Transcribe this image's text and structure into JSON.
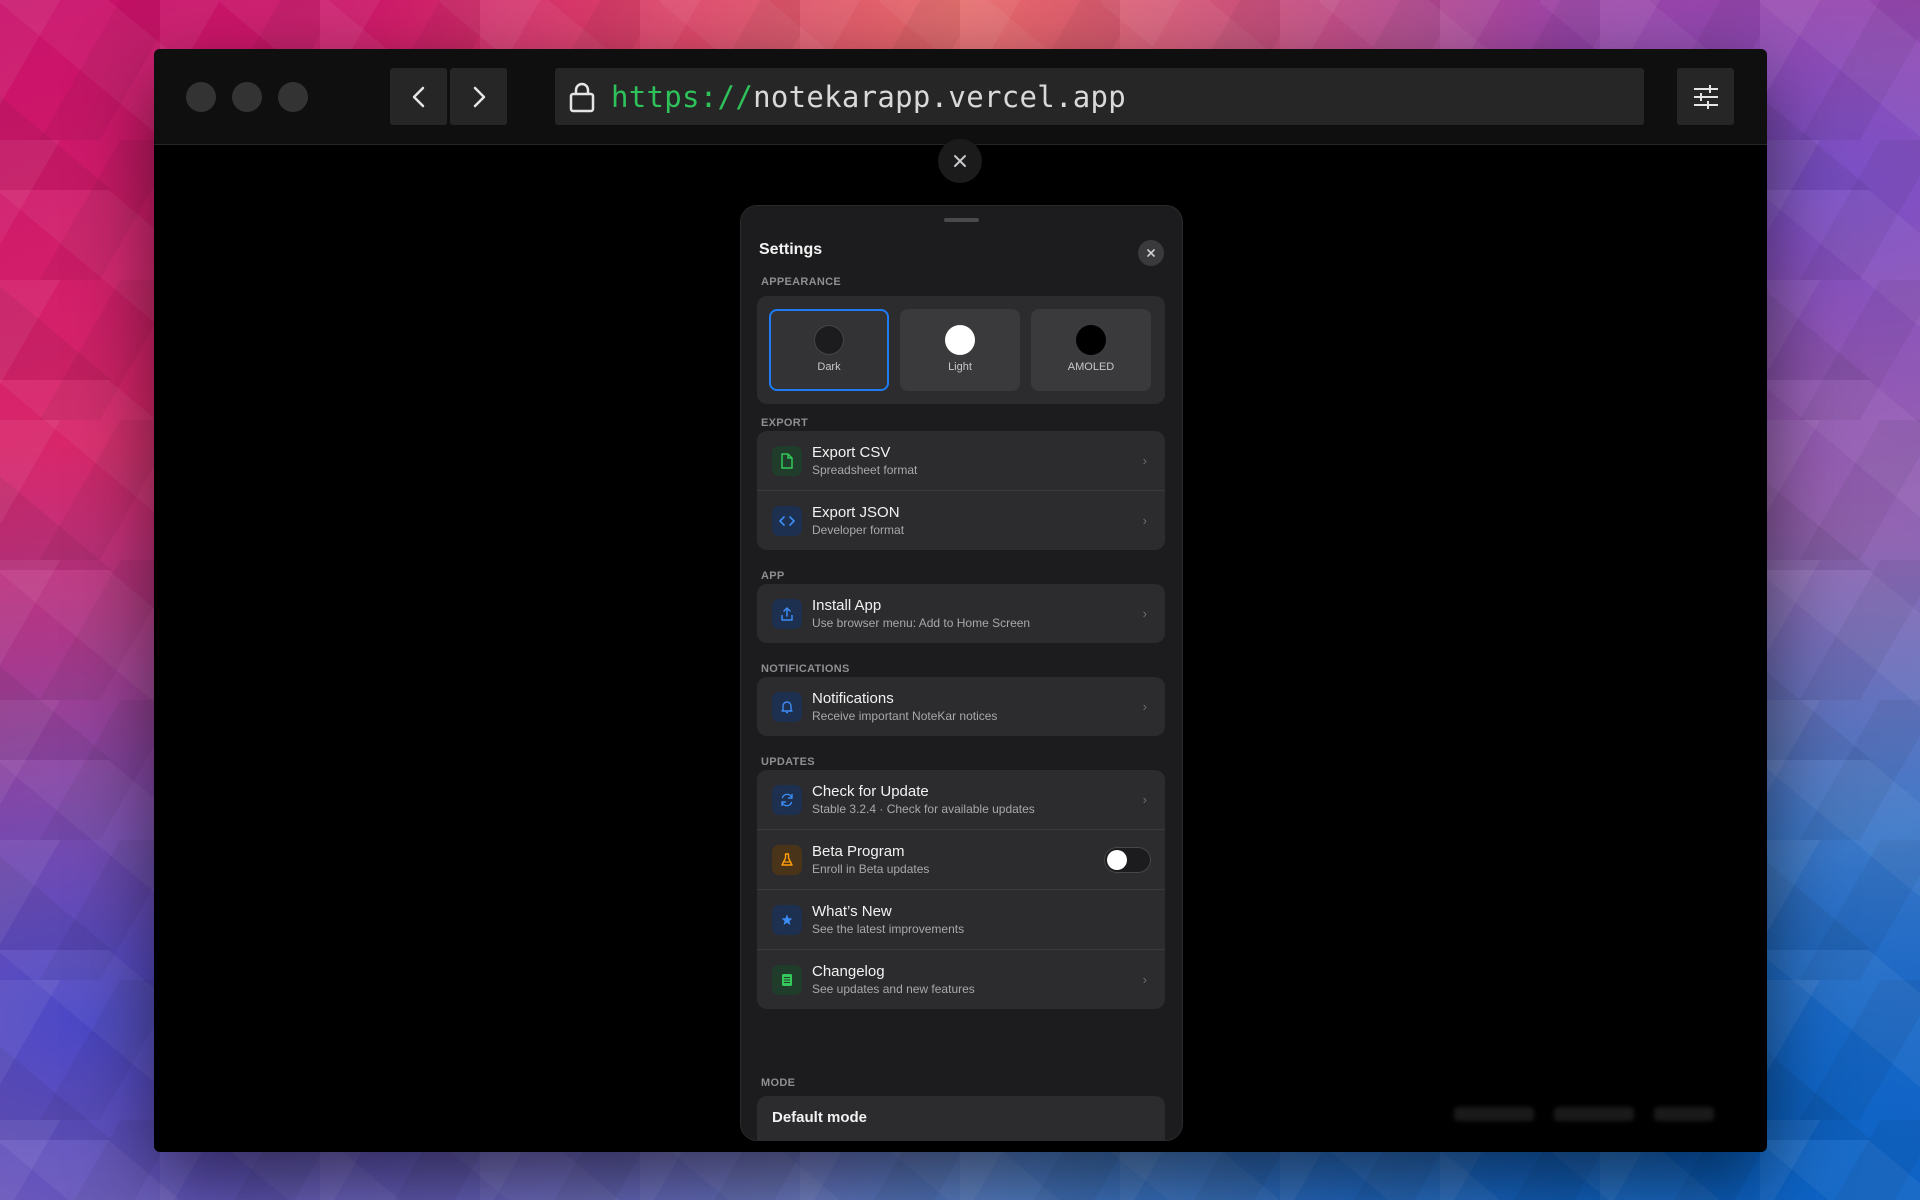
{
  "browser": {
    "url_scheme": "https://",
    "url_host": "notekarapp.vercel.app",
    "icons": {
      "back": "chevron-left-icon",
      "forward": "chevron-right-icon",
      "lock": "lock-icon",
      "menu": "sliders-icon"
    }
  },
  "settings": {
    "title": "Settings",
    "appearance": {
      "label": "APPEARANCE",
      "options": [
        {
          "name": "Dark",
          "swatch": "#1c1c1e"
        },
        {
          "name": "Light",
          "swatch": "#ffffff"
        },
        {
          "name": "AMOLED",
          "swatch": "#000000"
        }
      ],
      "selected": "Dark"
    },
    "export": {
      "label": "EXPORT",
      "items": [
        {
          "title": "Export CSV",
          "subtitle": "Spreadsheet format",
          "icon": "file-icon",
          "color": "#34c759"
        },
        {
          "title": "Export JSON",
          "subtitle": "Developer format",
          "icon": "code-icon",
          "color": "#1e7bf2"
        }
      ]
    },
    "app": {
      "label": "APP",
      "items": [
        {
          "title": "Install App",
          "subtitle": "Use browser menu: Add to Home Screen",
          "icon": "share-icon",
          "color": "#1e7bf2"
        }
      ]
    },
    "notifications": {
      "label": "NOTIFICATIONS",
      "items": [
        {
          "title": "Notifications",
          "subtitle": "Receive important NoteKar notices",
          "icon": "bell-icon",
          "color": "#1e7bf2"
        }
      ]
    },
    "updates": {
      "label": "UPDATES",
      "items": [
        {
          "title": "Check for Update",
          "subtitle": "Stable 3.2.4 · Check for available updates",
          "icon": "refresh-icon",
          "color": "#1e7bf2"
        },
        {
          "title": "Beta Program",
          "subtitle": "Enroll in Beta updates",
          "icon": "flask-icon",
          "color": "#ff9f0a",
          "toggle": false
        },
        {
          "title": "What’s New",
          "subtitle": "See the latest improvements",
          "icon": "star-icon",
          "color": "#1e7bf2"
        },
        {
          "title": "Changelog",
          "subtitle": "See updates and new features",
          "icon": "list-icon",
          "color": "#34c759"
        }
      ]
    },
    "mode": {
      "label": "MODE",
      "value": "Default mode"
    }
  }
}
